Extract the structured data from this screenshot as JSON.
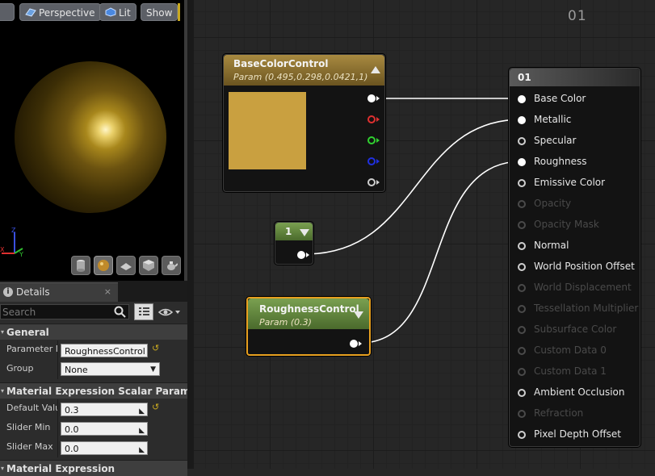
{
  "viewport": {
    "perspective_label": "Perspective",
    "lit_label": "Lit",
    "show_label": "Show"
  },
  "details": {
    "tab_label": "Details",
    "close_glyph": "×",
    "search_placeholder": "Search",
    "sections": {
      "general": "General",
      "scalar": "Material Expression Scalar Paramet",
      "expression": "Material Expression"
    },
    "props": {
      "parameter_name_label": "Parameter N",
      "parameter_name_value": "RoughnessControl",
      "group_label": "Group",
      "group_value": "None",
      "default_value_label": "Default Valu",
      "default_value_value": "0.3",
      "slider_min_label": "Slider Min",
      "slider_min_value": "0.0",
      "slider_max_label": "Slider Max",
      "slider_max_value": "0.0"
    }
  },
  "graph": {
    "title": "01",
    "base_color_node": {
      "title": "BaseColorControl",
      "subtitle": "Param (0.495,0.298,0.0421,1)",
      "swatch_color": "#c9a040"
    },
    "constant_node": {
      "title": "1"
    },
    "roughness_node": {
      "title": "RoughnessControl",
      "subtitle": "Param (0.3)"
    },
    "result_node": {
      "title": "01",
      "inputs": [
        {
          "label": "Base Color",
          "enabled": true,
          "connected": true
        },
        {
          "label": "Metallic",
          "enabled": true,
          "connected": true
        },
        {
          "label": "Specular",
          "enabled": true,
          "connected": false
        },
        {
          "label": "Roughness",
          "enabled": true,
          "connected": true
        },
        {
          "label": "Emissive Color",
          "enabled": true,
          "connected": false
        },
        {
          "label": "Opacity",
          "enabled": false,
          "connected": false
        },
        {
          "label": "Opacity Mask",
          "enabled": false,
          "connected": false
        },
        {
          "label": "Normal",
          "enabled": true,
          "connected": false
        },
        {
          "label": "World Position Offset",
          "enabled": true,
          "connected": false
        },
        {
          "label": "World Displacement",
          "enabled": false,
          "connected": false
        },
        {
          "label": "Tessellation Multiplier",
          "enabled": false,
          "connected": false
        },
        {
          "label": "Subsurface Color",
          "enabled": false,
          "connected": false
        },
        {
          "label": "Custom Data 0",
          "enabled": false,
          "connected": false
        },
        {
          "label": "Custom Data 1",
          "enabled": false,
          "connected": false
        },
        {
          "label": "Ambient Occlusion",
          "enabled": true,
          "connected": false
        },
        {
          "label": "Refraction",
          "enabled": false,
          "connected": false
        },
        {
          "label": "Pixel Depth Offset",
          "enabled": true,
          "connected": false
        }
      ]
    }
  }
}
